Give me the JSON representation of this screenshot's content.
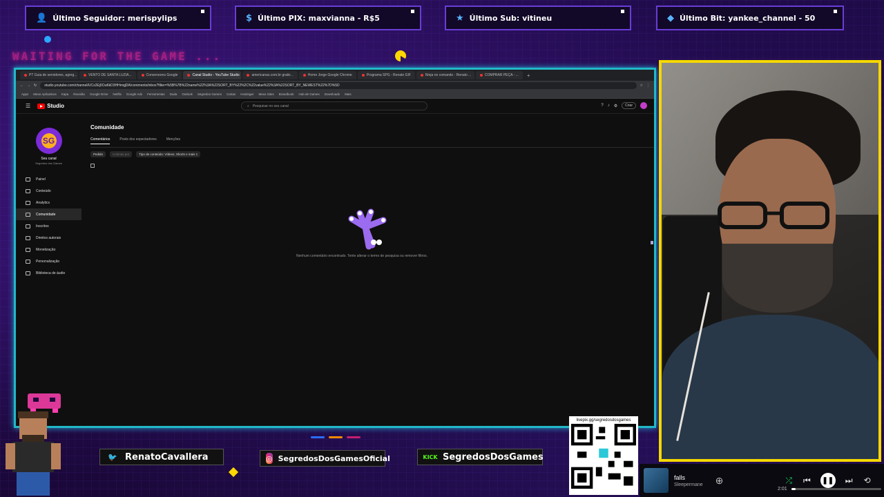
{
  "overlay": {
    "top_stats": [
      {
        "label": "Último Seguidor: merispylips",
        "icon": "user-icon"
      },
      {
        "label": "Último PIX: maxvianna - R$5",
        "icon": "dollar-icon"
      },
      {
        "label": "Último Sub: vitineu",
        "icon": "star-icon"
      },
      {
        "label": "Último Bit: yankee_channel - 50",
        "icon": "diamond-icon"
      }
    ],
    "waiting_text": "WAITING FOR THE GAME ...",
    "accent_cyan": "#22b8c8",
    "accent_yellow": "#f5d800",
    "accent_purple": "#6a3dd8"
  },
  "browser": {
    "tabs": [
      "PT Guia de servidores, agreg...",
      "VENTO DE SANTA LUZIA...",
      "Conversores Google",
      "Canal Studio - YouTube Studio",
      "americanas.com.br gratis ..",
      "Home Jorge Google Chrome",
      "Programa SPG - Renato GIF",
      "Ninja no comando - Renato ...",
      "COMPRAR PEÇA - ..."
    ],
    "active_tab_index": 3,
    "new_tab": "+",
    "address": "studio.youtube.com/channel/UCx2Ej0Cw6kD3HHmqjDA/comments/inbox?filter=%5B%7B%22name%22%3A%22SORT_BY%22%2C%22value%22%3A%22SORT_BY_NEWEST%22%7D%5D",
    "bookmarks": [
      "Apps",
      "Meus Aplicativos",
      "Kapa",
      "Reunião",
      "Google Drive",
      "Netflix",
      "Google Ads",
      "Ferramentas",
      "Duda",
      "Outlook",
      "Segredos Games",
      "Cartas",
      "Hostinger",
      "Meus Sites",
      "Brandbook",
      "Hub de Games",
      "Downloads",
      "Mais"
    ]
  },
  "studio": {
    "logo_text": "Studio",
    "search_placeholder": "Pesquisar no seu canal",
    "create_label": "Criar",
    "channel_name": "Seu canal",
    "channel_sub": "Segredos dos Games",
    "nav": [
      {
        "label": "Painel",
        "active": false
      },
      {
        "label": "Conteúdo",
        "active": false
      },
      {
        "label": "Analytics",
        "active": false
      },
      {
        "label": "Comunidade",
        "active": true
      },
      {
        "label": "Inscritos",
        "active": false
      },
      {
        "label": "Direitos autorais",
        "active": false
      },
      {
        "label": "Monetização",
        "active": false
      },
      {
        "label": "Personalização",
        "active": false
      },
      {
        "label": "Biblioteca de áudio",
        "active": false
      }
    ],
    "page_title": "Comunidade",
    "subtabs": [
      "Comentários",
      "Posts dos espectadores",
      "Menções"
    ],
    "active_subtab_index": 0,
    "filters": [
      {
        "label": "Pedido",
        "dim": false
      },
      {
        "label": "Colunas por",
        "dim": true
      },
      {
        "label": "Tipo de conteúdo: Vídeos, Shorts e mais 1",
        "dim": false
      }
    ],
    "empty_message": "Nenhum comentário encontrado. Tente alterar o termo de pesquisa ou remover filtros."
  },
  "bottom": {
    "twitter": "RenatoCavallera",
    "instagram": "SegredosDosGamesOficial",
    "kick_logo": "KICK",
    "kick": "SegredosDosGames",
    "qr_label": "livepix.gg/segredosdosgames"
  },
  "music": {
    "title": "falls",
    "artist": "Sleepermane",
    "elapsed": "2:01",
    "progress": 0.05,
    "add_icon": "plus-circle-icon"
  }
}
